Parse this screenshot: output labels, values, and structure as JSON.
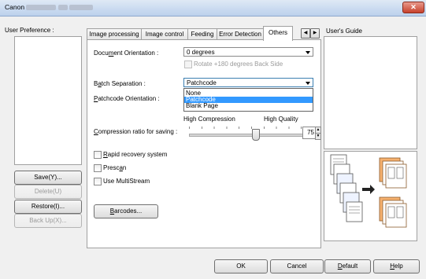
{
  "window": {
    "title_prefix": "Canon",
    "close_label": "✕"
  },
  "left": {
    "user_preference_label": "User Preference :",
    "buttons": {
      "save": "Save(Y)...",
      "delete": "Delete(U)",
      "restore": "Restore(I)...",
      "backup": "Back Up(X)..."
    }
  },
  "tabs": {
    "items": [
      "Image processing",
      "Image control",
      "Feeding",
      "Error Detection",
      "Others"
    ],
    "active": "Others",
    "scroll_left": "◀",
    "scroll_right": "▶"
  },
  "others": {
    "doc_orientation_label": "Document Orientation :",
    "doc_orientation_value": "0 degrees",
    "rotate_back_label": "Rotate +180 degrees Back Side",
    "batch_sep_label": "Batch Separation :",
    "batch_sep_value": "Patchcode",
    "batch_sep_options": [
      "None",
      "Patchcode",
      "Blank Page"
    ],
    "batch_sep_selected_index": 1,
    "patchcode_orientation_label": "Patchcode Orientation :",
    "high_compression": "High Compression",
    "high_quality": "High Quality",
    "compression_label": "Compression ratio for saving :",
    "compression_value": "75",
    "rapid_recovery_label": "Rapid recovery system",
    "prescan_label": "Prescan",
    "multistream_label": "Use MultiStream",
    "barcodes_button": "Barcodes..."
  },
  "right": {
    "users_guide_label": "User's Guide"
  },
  "footer": {
    "ok": "OK",
    "cancel": "Cancel",
    "default": "Default",
    "help": "Help"
  },
  "colors": {
    "selection": "#3399ff",
    "orange_stack": "#f4a460"
  }
}
